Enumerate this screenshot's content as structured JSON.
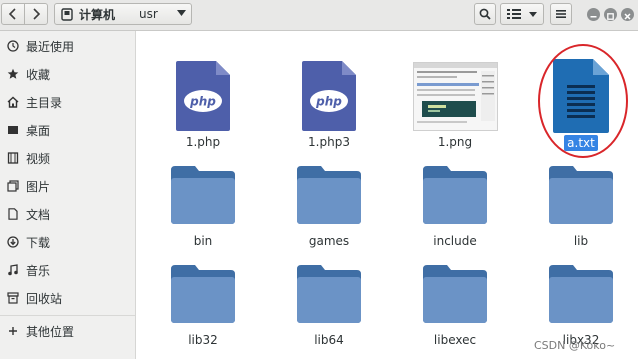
{
  "header": {
    "path_home": "计算机",
    "path_current": "usr"
  },
  "sidebar": {
    "items": [
      {
        "label": "最近使用",
        "icon": "clock-icon"
      },
      {
        "label": "收藏",
        "icon": "star-icon"
      },
      {
        "label": "主目录",
        "icon": "home-icon"
      },
      {
        "label": "桌面",
        "icon": "desktop-icon"
      },
      {
        "label": "视频",
        "icon": "video-icon"
      },
      {
        "label": "图片",
        "icon": "picture-icon"
      },
      {
        "label": "文档",
        "icon": "document-icon"
      },
      {
        "label": "下载",
        "icon": "download-icon"
      },
      {
        "label": "音乐",
        "icon": "music-icon"
      },
      {
        "label": "回收站",
        "icon": "trash-icon"
      },
      {
        "label": "其他位置",
        "icon": "plus-icon"
      }
    ]
  },
  "files": [
    {
      "name": "1.php",
      "kind": "php"
    },
    {
      "name": "1.php3",
      "kind": "php"
    },
    {
      "name": "1.png",
      "kind": "image"
    },
    {
      "name": "a.txt",
      "kind": "text",
      "selected": true
    },
    {
      "name": "bin",
      "kind": "folder"
    },
    {
      "name": "games",
      "kind": "folder"
    },
    {
      "name": "include",
      "kind": "folder"
    },
    {
      "name": "lib",
      "kind": "folder"
    },
    {
      "name": "lib32",
      "kind": "folder"
    },
    {
      "name": "lib64",
      "kind": "folder"
    },
    {
      "name": "libexec",
      "kind": "folder"
    },
    {
      "name": "libx32",
      "kind": "folder"
    }
  ],
  "php_badge": "php",
  "watermark": "CSDN @Koko~",
  "colors": {
    "folder": "#5f85b5",
    "php_doc": "#4e5faa",
    "text_doc": "#1f6db3",
    "selection": "#3584e4",
    "annotation": "#d9262a"
  }
}
